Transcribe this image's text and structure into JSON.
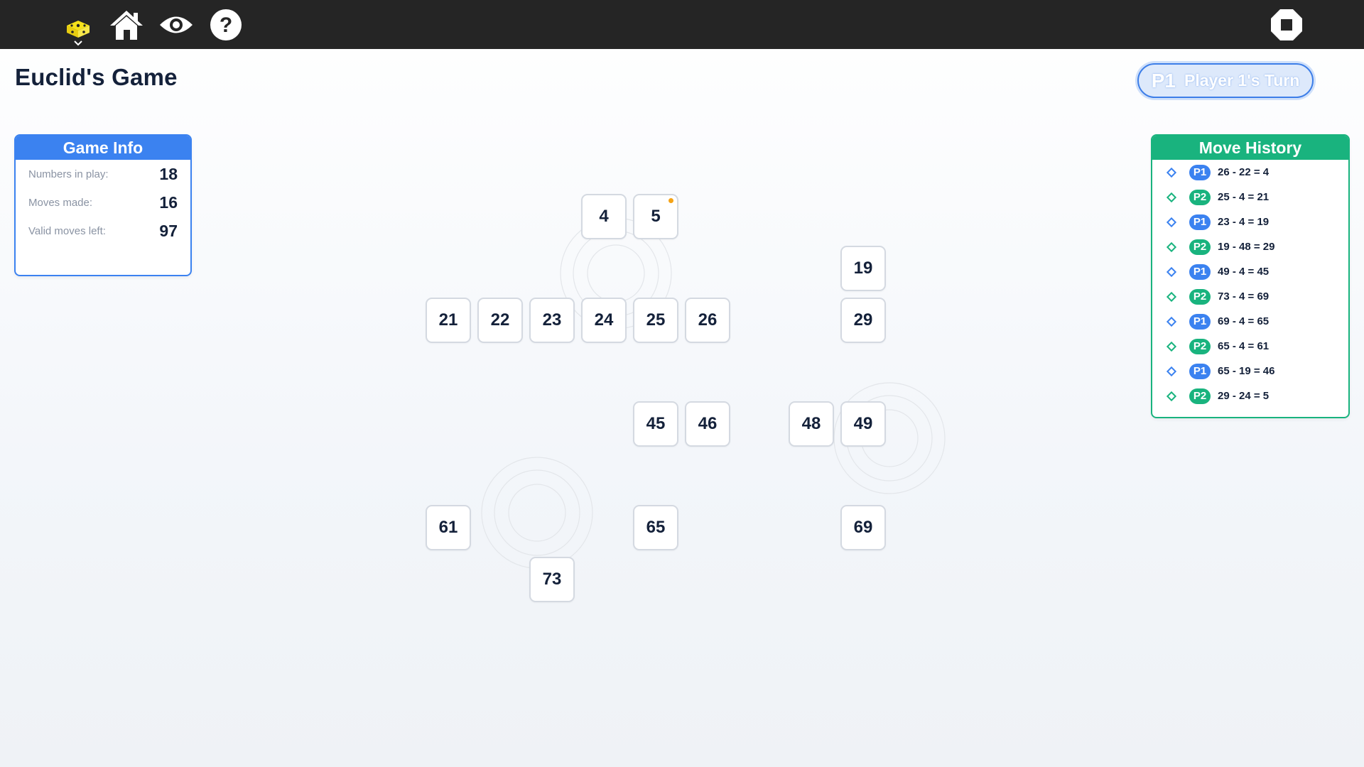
{
  "toolbar": {
    "icons": [
      "logo-icon",
      "home-icon",
      "eye-icon",
      "help-icon",
      "stop-icon"
    ]
  },
  "title": "Euclid's Game",
  "turn": {
    "player": "P1",
    "text": "Player 1's Turn"
  },
  "game_info": {
    "title": "Game Info",
    "rows": [
      {
        "label": "Numbers in play:",
        "value": "18"
      },
      {
        "label": "Moves made:",
        "value": "16"
      },
      {
        "label": "Valid moves left:",
        "value": "97"
      }
    ]
  },
  "move_history": {
    "title": "Move History",
    "items": [
      {
        "player": "P1",
        "move": "26 - 22 = 4"
      },
      {
        "player": "P2",
        "move": "25 - 4 = 21"
      },
      {
        "player": "P1",
        "move": "23 - 4 = 19"
      },
      {
        "player": "P2",
        "move": "19 - 48 = 29"
      },
      {
        "player": "P1",
        "move": "49 - 4 = 45"
      },
      {
        "player": "P2",
        "move": "73 - 4 = 69"
      },
      {
        "player": "P1",
        "move": "69 - 4 = 65"
      },
      {
        "player": "P2",
        "move": "65 - 4 = 61"
      },
      {
        "player": "P1",
        "move": "65 - 19 = 46"
      },
      {
        "player": "P2",
        "move": "29 - 24 = 5"
      }
    ]
  },
  "board": {
    "tiles": [
      "4",
      "5",
      "19",
      "21",
      "22",
      "23",
      "24",
      "25",
      "26",
      "29",
      "45",
      "46",
      "48",
      "49",
      "61",
      "65",
      "69",
      "73"
    ],
    "highlighted": "5"
  },
  "colors": {
    "p1": "#3b82f0",
    "p2": "#19b37e",
    "topbar": "#252525",
    "accent_dot": "#f5a316"
  }
}
